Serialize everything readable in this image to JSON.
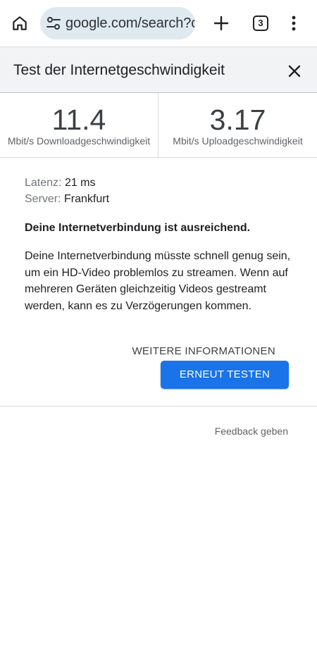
{
  "browser": {
    "url": "google.com/search?c",
    "tab_count": "3",
    "icons": {
      "home": "home-icon",
      "site_settings": "tune-icon",
      "new_tab": "plus-icon",
      "tab_switcher": "tabs-icon",
      "menu": "more-vert-icon"
    }
  },
  "speedtest": {
    "title": "Test der Internetgeschwindigkeit",
    "close_icon": "close-icon",
    "download": {
      "value": "11.4",
      "label": "Mbit/s Downloadgeschwindigkeit"
    },
    "upload": {
      "value": "3.17",
      "label": "Mbit/s Uploadgeschwindigkeit"
    },
    "latency": {
      "label": "Latenz:",
      "value": "21 ms"
    },
    "server": {
      "label": "Server:",
      "value": "Frankfurt"
    },
    "verdict": "Deine Internetverbindung ist ausreichend.",
    "description": "Deine Internetverbindung müsste schnell genug sein, um ein HD-Video problemlos zu streamen. Wenn auf mehreren Geräten gleichzeitig Videos gestreamt werden, kann es zu Verzögerungen kommen.",
    "more_info_label": "WEITERE INFORMATIONEN",
    "retest_label": "ERNEUT TESTEN",
    "feedback_label": "Feedback geben"
  },
  "colors": {
    "accent": "#1a73e8",
    "header_bg": "#f1f3f4",
    "url_bar_bg": "#dfe9f0"
  }
}
